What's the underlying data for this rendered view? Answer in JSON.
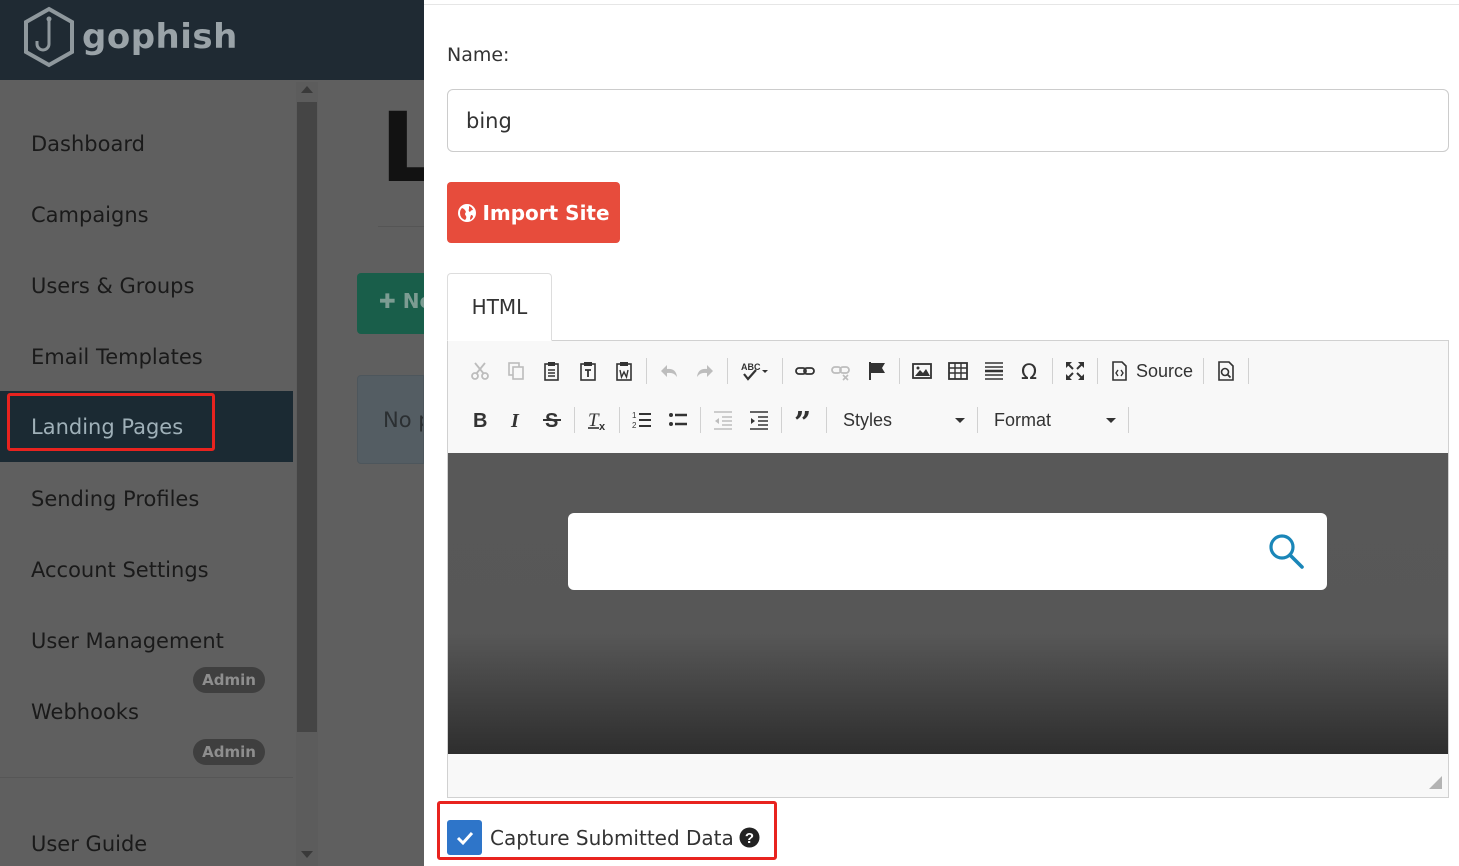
{
  "brand": {
    "name": "gophish",
    "logo": "gophish-hook-hexagon-logo"
  },
  "sidebar": {
    "items": [
      {
        "label": "Dashboard"
      },
      {
        "label": "Campaigns"
      },
      {
        "label": "Users & Groups"
      },
      {
        "label": "Email Templates"
      },
      {
        "label": "Landing Pages",
        "active": true
      },
      {
        "label": "Sending Profiles"
      },
      {
        "label": "Account Settings"
      },
      {
        "label": "User Management",
        "badge": "Admin"
      },
      {
        "label": "Webhooks",
        "badge": "Admin"
      },
      {
        "label": "User Guide"
      }
    ]
  },
  "background_page": {
    "heading_fragment": "L",
    "new_button_fragment": "Ne",
    "info_fragment": "No p"
  },
  "modal": {
    "name_label": "Name:",
    "name_value": "bing",
    "import_button": "Import Site",
    "tab_label": "HTML",
    "editor": {
      "toolbar_row1": [
        "cut-icon",
        "copy-icon",
        "paste-icon",
        "paste-text-icon",
        "paste-word-icon",
        "undo-icon",
        "redo-icon",
        "spellcheck-icon",
        "link-icon",
        "unlink-icon",
        "anchor-flag-icon",
        "image-icon",
        "table-icon",
        "horizontal-rule-icon",
        "special-char-omega-icon",
        "maximize-icon",
        "source-icon",
        "preview-icon"
      ],
      "source_label": "Source",
      "toolbar_row2": [
        "bold-icon",
        "italic-icon",
        "strikethrough-icon",
        "remove-format-icon",
        "numbered-list-icon",
        "bulleted-list-icon",
        "outdent-icon",
        "indent-icon",
        "blockquote-icon"
      ],
      "styles_label": "Styles",
      "format_label": "Format"
    },
    "capture_label": "Capture Submitted Data",
    "capture_checked": true
  },
  "colors": {
    "import_button": "#e74c3c",
    "checkbox": "#2e75c9",
    "annotation": "#e8231f",
    "search_icon": "#1a86b8"
  }
}
